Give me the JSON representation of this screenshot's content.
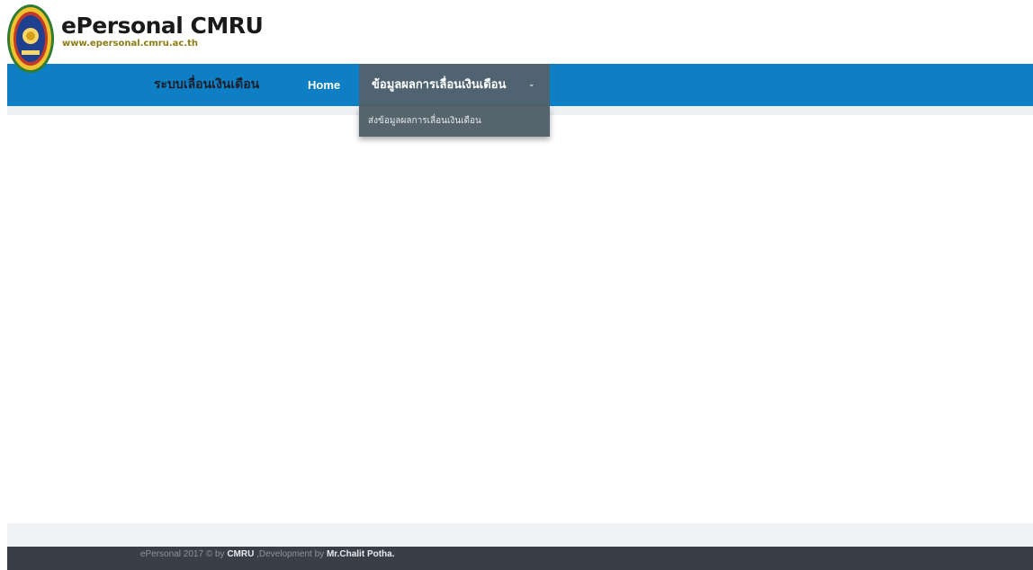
{
  "header": {
    "title": "ePersonal CMRU",
    "url": "www.epersonal.cmru.ac.th",
    "logo_icon": "university-seal-icon"
  },
  "navbar": {
    "brand": "ระบบเลื่อนเงินเดือน",
    "home": "Home",
    "dropdown_label": "ข้อมูลผลการเลื่อนเงินเดือน",
    "dropdown_chevron": "⌄",
    "dropdown_items": [
      "ส่งข้อมูลผลการเลื่อนเงินเดือน"
    ],
    "bar_color": "#0e7fc4",
    "active_color": "#4f6371"
  },
  "footer": {
    "prefix": "ePersonal 2017 © by ",
    "org": "CMRU",
    "middle": " ,Development by ",
    "developer": "Mr.Chalit Potha."
  }
}
